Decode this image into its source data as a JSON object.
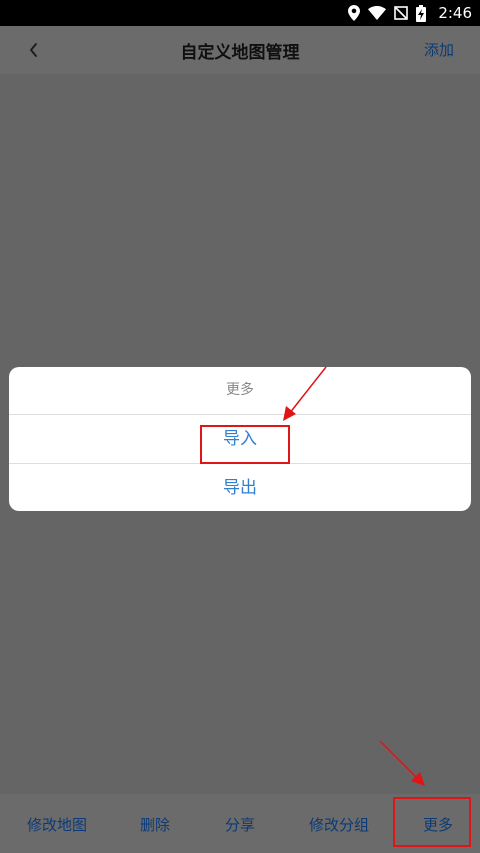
{
  "status_bar": {
    "time": "2:46",
    "icons": [
      "location-icon",
      "wifi-icon",
      "no-sim-icon",
      "battery-charging-icon"
    ]
  },
  "header": {
    "title": "自定义地图管理",
    "add_label": "添加",
    "back_icon": "chevron-left-icon"
  },
  "sheet": {
    "title": "更多",
    "items": [
      {
        "label": "导入"
      },
      {
        "label": "导出"
      }
    ]
  },
  "tabs": [
    {
      "label": "修改地图"
    },
    {
      "label": "删除"
    },
    {
      "label": "分享"
    },
    {
      "label": "修改分组"
    },
    {
      "label": "更多"
    }
  ],
  "colors": {
    "overlay": "#656565",
    "accent": "#2f7fd3",
    "nav_link": "#0b3a77",
    "annotation": "#e01515"
  }
}
